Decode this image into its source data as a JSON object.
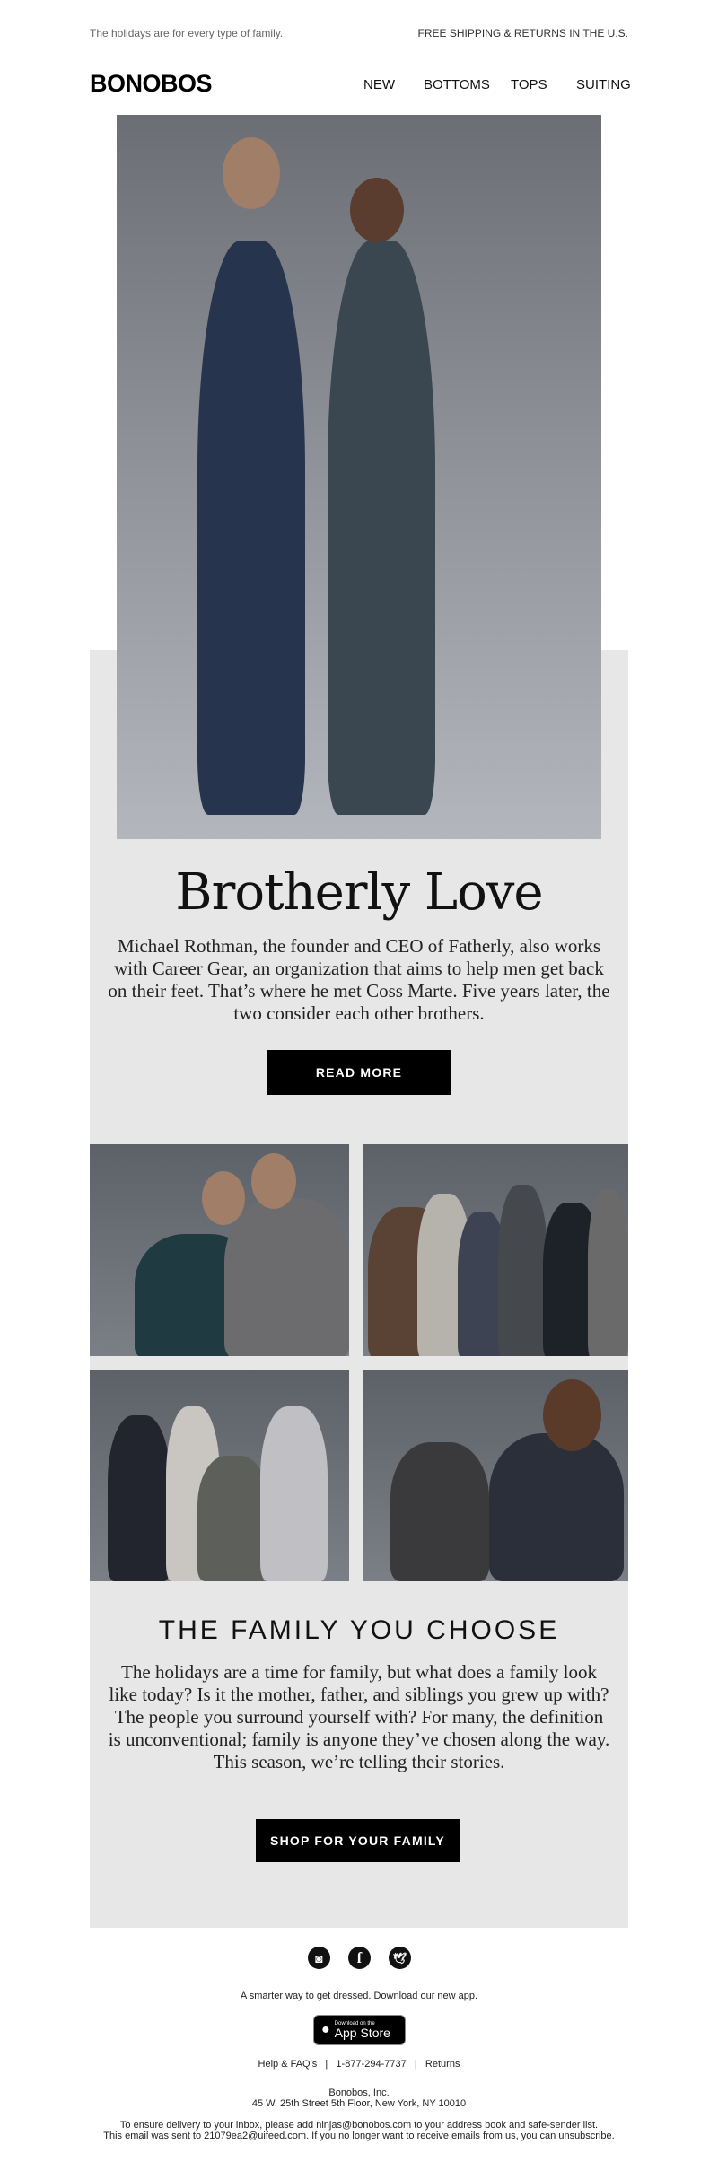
{
  "header": {
    "preheader": "The holidays are for every type of family.",
    "shipping": "FREE SHIPPING & RETURNS IN THE U.S.",
    "logo": "BONOBOS",
    "nav": [
      "NEW",
      "BOTTOMS",
      "TOPS",
      "SUITING"
    ]
  },
  "feature": {
    "title": "Brotherly Love",
    "body": "Michael Rothman, the founder and CEO of Fatherly, also works with Career Gear, an organization that aims to help men get back on their feet. That’s where he met Coss Marte. Five years later, the two consider each other brothers.",
    "button": "READ MORE"
  },
  "family": {
    "heading": "THE FAMILY YOU CHOOSE",
    "body": "The holidays are a time for family, but what does a family look like today? Is it the mother, father, and siblings you grew up with? The people you surround yourself with? For many, the definition is unconventional; family is anyone they’ve chosen along the way. This season, we’re telling their stories.",
    "button": "SHOP FOR YOUR FAMILY"
  },
  "footer": {
    "social": [
      "instagram-icon",
      "facebook-icon",
      "twitter-icon"
    ],
    "tagline": "A smarter way to get dressed. Download our new app.",
    "app_badge": {
      "line1": "Download on the",
      "line2": "App Store"
    },
    "links": [
      "Help & FAQ's",
      "1-877-294-7737",
      "Returns"
    ],
    "separator": "|",
    "company": "Bonobos, Inc.",
    "address": "45 W. 25th Street 5th Floor, New York, NY 10010",
    "delivery_note": "To ensure delivery to your inbox, please add ninjas@bonobos.com to your address book and safe-sender list.",
    "sent_note": "This email was sent to 21079ea2@uifeed.com. If you no longer want to receive emails from us, you can",
    "unsubscribe": "unsubscribe",
    "period": "."
  },
  "colors": {
    "panel": "#e7e7e7",
    "button": "#000000"
  }
}
